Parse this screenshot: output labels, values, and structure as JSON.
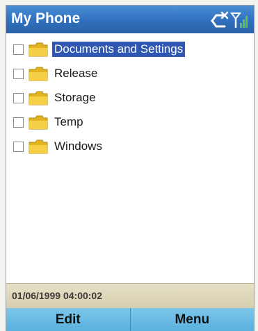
{
  "titlebar": {
    "title": "My Phone",
    "icons": [
      "connection-off-icon",
      "signal-strength-icon"
    ]
  },
  "tree": {
    "items": [
      {
        "label": "Documents and Settings",
        "selected": true,
        "checked": false,
        "icon": "folder-icon"
      },
      {
        "label": "Release",
        "selected": false,
        "checked": false,
        "icon": "folder-icon"
      },
      {
        "label": "Storage",
        "selected": false,
        "checked": false,
        "icon": "folder-icon"
      },
      {
        "label": "Temp",
        "selected": false,
        "checked": false,
        "icon": "folder-icon"
      },
      {
        "label": "Windows",
        "selected": false,
        "checked": false,
        "icon": "folder-icon"
      }
    ]
  },
  "status": {
    "datetime": "01/06/1999 04:00:02"
  },
  "softkeys": {
    "left_label": "Edit",
    "right_label": "Menu"
  },
  "colors": {
    "titlebar": "#2f6fbd",
    "selection": "#2f56b0",
    "softkeys": "#6cbbe3",
    "datebar": "#dcd5b8",
    "folder": "#f2c230"
  }
}
